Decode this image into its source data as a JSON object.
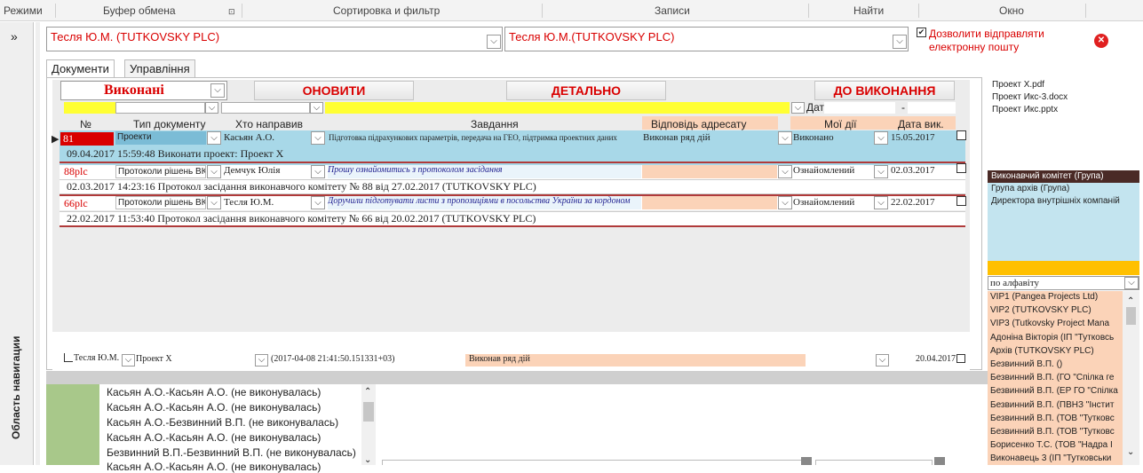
{
  "ribbon": {
    "groups": [
      "Режими",
      "Буфер обмена",
      "Сортировка и фильтр",
      "Записи",
      "Найти",
      "Окно"
    ]
  },
  "nav": {
    "expand": "»",
    "label": "Область навигации"
  },
  "top": {
    "user_left": "Тесля Ю.М. (TUTKOVSKY PLC)",
    "user_right": "Тесля Ю.М.(TUTKOVSKY PLC)",
    "email_allow": "Дозволити відправляти електронну пошту",
    "close": "✕"
  },
  "tabs": [
    "Документи",
    "Управління"
  ],
  "toolbar": {
    "filter": "Виконані",
    "refresh": "ОНОВИТИ",
    "details": "ДЕТАЛЬНО",
    "todo": "ДО ВИКОНАННЯ",
    "date_label": "Дата",
    "date_dash": "-"
  },
  "columns": {
    "num": "№",
    "type": "Тип документу",
    "from": "Хто направив",
    "task": "Завдання",
    "reply": "Відповідь адресату",
    "actions": "Мої дії",
    "due": "Дата вик."
  },
  "rows": [
    {
      "num": "81",
      "type": "Проекти",
      "from": "Касьян А.О.",
      "task": "Підготовка підрахункових параметрів, передача на ГЕО, підтримка проектних даних",
      "reply": "Виконав ряд дій",
      "action": "Виконано",
      "due": "15.05.2017",
      "sub": "09.04.2017 15:59:48 Виконати проект: Проект Х"
    },
    {
      "num": "88plc",
      "type": "Протоколи рішень ВК",
      "from": "Демчук Юлія",
      "task": "Прошу ознайомитись з протоколом засідання",
      "reply": "",
      "action": "Ознайомлений",
      "due": "02.03.2017",
      "sub": "02.03.2017 14:23:16 Протокол засідання виконавчого комітету № 88 від 27.02.2017 (TUTKOVSKY PLC)"
    },
    {
      "num": "66plc",
      "type": "Протоколи рішень ВК",
      "from": "Тесля Ю.М.",
      "task": "Доручили підготувати листи з пропозиціями в посольства України за кордоном",
      "reply": "",
      "action": "Ознайомлений",
      "due": "22.02.2017",
      "sub": "22.02.2017 11:53:40 Протокол засідання виконавчого комітету № 66 від 20.02.2017 (TUTKOVSKY PLC)"
    }
  ],
  "footer": {
    "user": "Тесля Ю.М.",
    "project": "Проект Х",
    "stamp": "(2017-04-08 21:41:50.151331+03)",
    "reply": "Виконав ряд дій",
    "date": "20.04.2017"
  },
  "history": [
    "Касьян А.О.-Касьян А.О. (не виконувалась)",
    "Касьян А.О.-Касьян А.О. (не виконувалась)",
    "Касьян А.О.-Безвинний В.П. (не виконувалась)",
    "Касьян А.О.-Касьян А.О. (не виконувалась)",
    "Безвинний В.П.-Безвинний В.П. (не виконувалась)",
    "Касьян А.О.-Касьян А.О. (не виконувалась)"
  ],
  "files": [
    "Проект Х.pdf",
    "Проект Икс-3.docx",
    "Проект Икс.pptx"
  ],
  "groups": [
    "Виконавчий комітет (Група)",
    "Група архів (Група)",
    "Директора внутрішніх компаній"
  ],
  "sort": "по алфавіту",
  "contacts": [
    "VIP1 (Pangea Projects Ltd)",
    "VIP2 (TUTKOVSKY PLC)",
    "VIP3 (Tutkovsky Project Mana",
    "Адоніна Вікторія (ІП \"Тутковсь",
    "Архів (TUTKOVSKY PLC)",
    "Безвинний В.П. ()",
    "Безвинний В.П. (ГО \"Спілка ге",
    "Безвинний В.П. (ЕР ГО \"Спілка",
    "Безвинний В.П. (ПВНЗ \"Інстит",
    "Безвинний В.П. (ТОВ \"Тутковс",
    "Безвинний В.П. (ТОВ \"Тутковс",
    "Борисенко Т.С. (ТОВ \"Надра І",
    "Виконавець 3 (ІП \"Тутковськи"
  ],
  "colors": {
    "row_blue": "#a8d8e8",
    "row_peach": "#fbd3b8",
    "yellow": "#ffff33",
    "accent_red": "#d90000",
    "green": "#a8c88a"
  }
}
